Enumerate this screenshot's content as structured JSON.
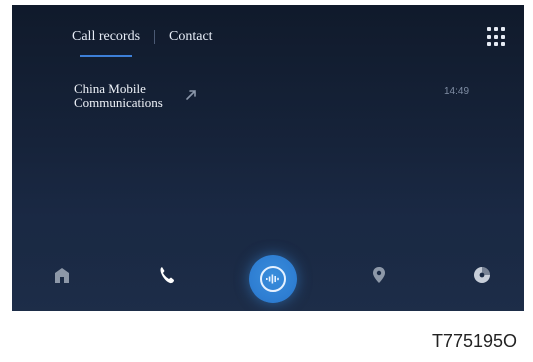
{
  "tabs": [
    {
      "label": "Call records",
      "active": true
    },
    {
      "label": "Contact",
      "active": false
    }
  ],
  "records": [
    {
      "name": "China Mobile Communications",
      "time": "14:49",
      "type": "outgoing"
    }
  ],
  "dock": [
    "home-icon",
    "phone-icon",
    "voice-assistant-icon",
    "location-icon",
    "music-icon"
  ],
  "caption": "T775195O",
  "colors": {
    "accent": "#2f7fd3",
    "background": "#16233a"
  }
}
